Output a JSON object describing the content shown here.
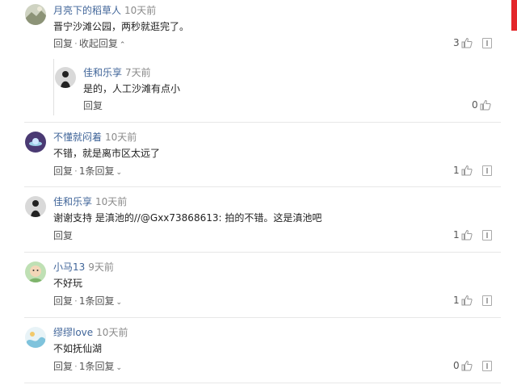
{
  "accent_color": "#406599",
  "comments": [
    {
      "user": "月亮下的稻草人",
      "time": "10天前",
      "text": "晋宁沙滩公园，两秒就逛完了。",
      "actions": {
        "reply": "回复",
        "sep": "·",
        "collapse": "收起回复",
        "chevron": "⌃"
      },
      "likes": "3",
      "avatar_icon": "landscape-avatar"
    },
    {
      "user": "佳和乐享",
      "time": "7天前",
      "text": "是的，人工沙滩有点小",
      "actions": {
        "reply": "回复"
      },
      "likes": "0",
      "avatar_icon": "silhouette-avatar",
      "is_reply": true
    },
    {
      "user": "不懂就闷着",
      "time": "10天前",
      "text": "不错，就是离市区太远了",
      "actions": {
        "reply": "回复",
        "sep": "·",
        "expand": "1条回复",
        "chevron": "⌄"
      },
      "likes": "1",
      "avatar_icon": "space-avatar"
    },
    {
      "user": "佳和乐享",
      "time": "10天前",
      "text": "谢谢支持 是滇池的//@Gxx73868613: 拍的不错。这是滇池吧",
      "actions": {
        "reply": "回复"
      },
      "likes": "1",
      "avatar_icon": "silhouette-avatar"
    },
    {
      "user": "小马13",
      "time": "9天前",
      "text": "不好玩",
      "actions": {
        "reply": "回复",
        "sep": "·",
        "expand": "1条回复",
        "chevron": "⌄"
      },
      "likes": "1",
      "avatar_icon": "cartoon-avatar"
    },
    {
      "user": "缪缪love",
      "time": "10天前",
      "text": "不如抚仙湖",
      "actions": {
        "reply": "回复",
        "sep": "·",
        "expand": "1条回复",
        "chevron": "⌄"
      },
      "likes": "0",
      "avatar_icon": "wave-avatar"
    }
  ]
}
